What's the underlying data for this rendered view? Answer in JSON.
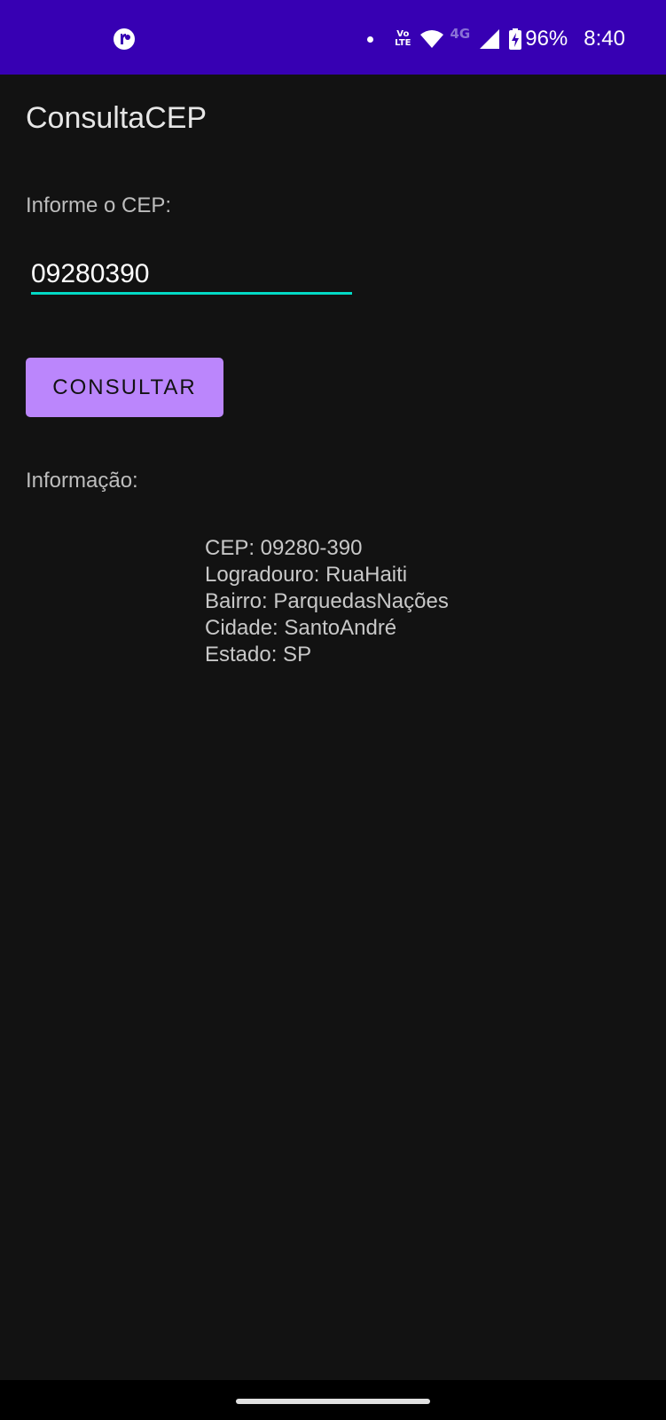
{
  "status_bar": {
    "volte_top": "Vo",
    "volte_bottom": "LTE",
    "network_type": "4G",
    "battery": "96%",
    "time": "8:40",
    "background": "#3700b3",
    "icons": [
      "app-notification-icon",
      "dot-icon",
      "volte-icon",
      "wifi-icon",
      "signal-icon",
      "battery-charging-icon"
    ]
  },
  "app": {
    "title": "ConsultaCEP"
  },
  "form": {
    "prompt": "Informe o CEP:",
    "cep_value": "09280390",
    "button_label": "CONSULTAR",
    "accent_color": "#03dac5",
    "button_color": "#bb86fc"
  },
  "result": {
    "label": "Informação:",
    "lines": [
      "CEP: 09280-390",
      "Logradouro: RuaHaiti",
      "Bairro: ParquedasNações",
      "Cidade: SantoAndré",
      "Estado: SP"
    ]
  }
}
